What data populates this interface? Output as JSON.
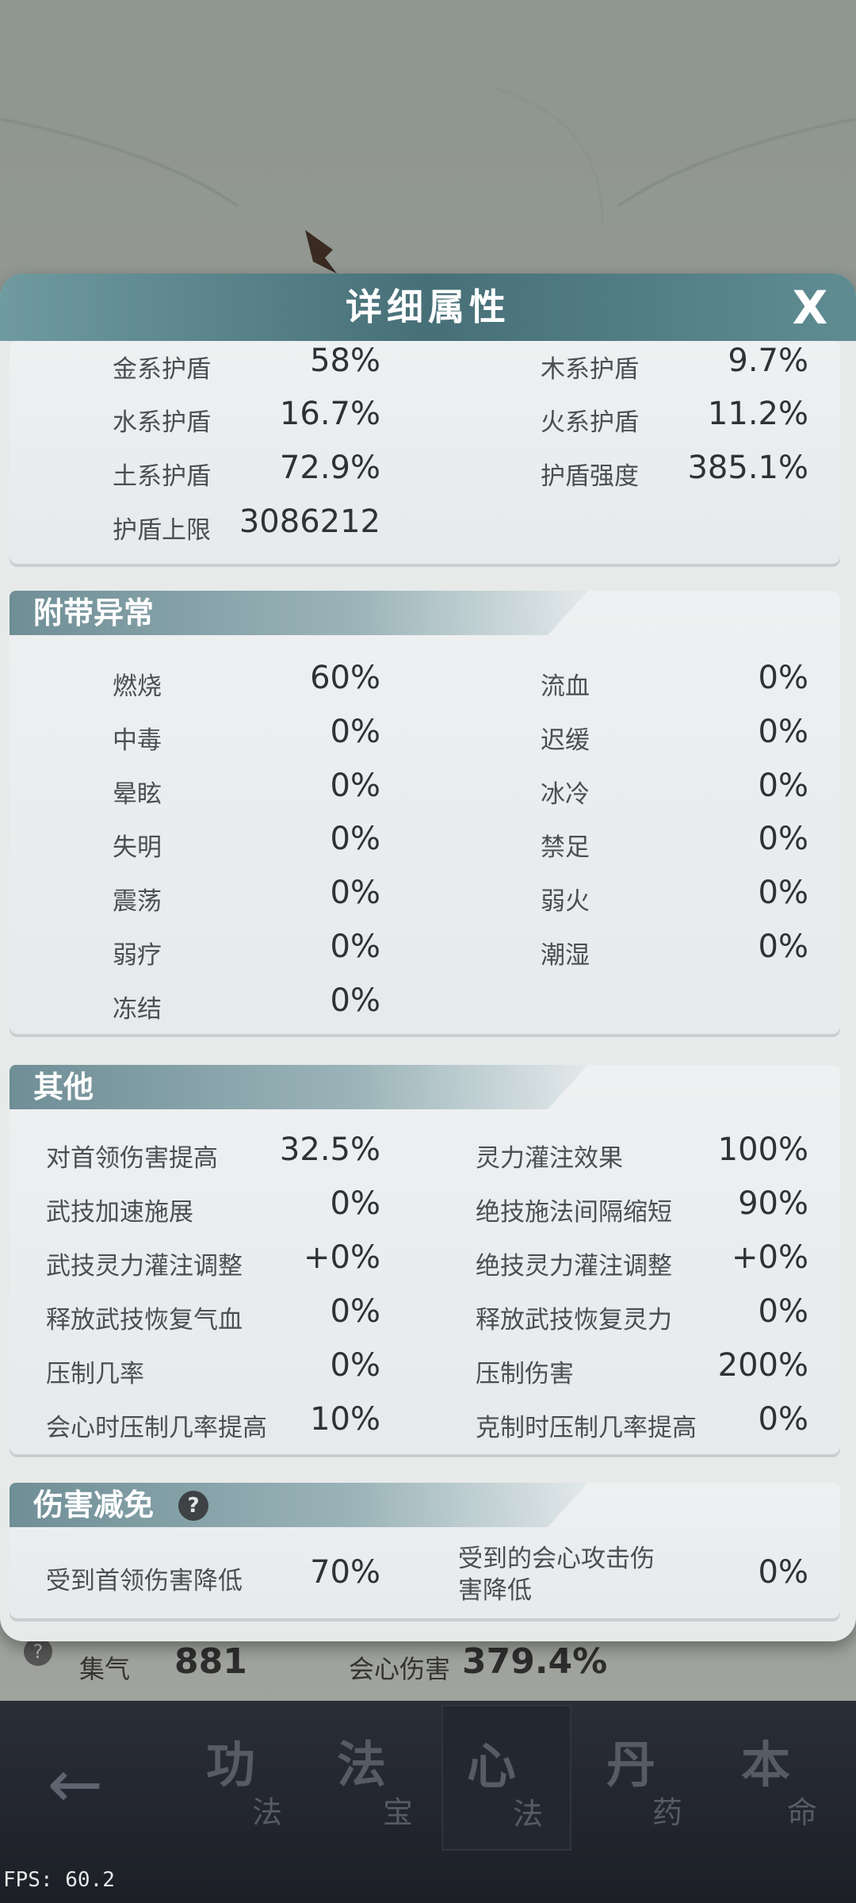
{
  "background": {
    "under_stats": {
      "left_label": "集气",
      "left_value": "881",
      "right_label": "会心伤害",
      "right_value": "379.4%"
    }
  },
  "dialog": {
    "title": "详细属性",
    "close_label": "X"
  },
  "shield": {
    "rows": [
      {
        "left_label": "金系护盾",
        "left_value": "58%",
        "right_label": "木系护盾",
        "right_value": "9.7%"
      },
      {
        "left_label": "水系护盾",
        "left_value": "16.7%",
        "right_label": "火系护盾",
        "right_value": "11.2%"
      },
      {
        "left_label": "土系护盾",
        "left_value": "72.9%",
        "right_label": "护盾强度",
        "right_value": "385.1%"
      },
      {
        "left_label": "护盾上限",
        "left_value": "3086212",
        "right_label": "",
        "right_value": ""
      }
    ]
  },
  "abnormal": {
    "title": "附带异常",
    "rows": [
      {
        "left_label": "燃烧",
        "left_value": "60%",
        "right_label": "流血",
        "right_value": "0%"
      },
      {
        "left_label": "中毒",
        "left_value": "0%",
        "right_label": "迟缓",
        "right_value": "0%"
      },
      {
        "left_label": "晕眩",
        "left_value": "0%",
        "right_label": "冰冷",
        "right_value": "0%"
      },
      {
        "left_label": "失明",
        "left_value": "0%",
        "right_label": "禁足",
        "right_value": "0%"
      },
      {
        "left_label": "震荡",
        "left_value": "0%",
        "right_label": "弱火",
        "right_value": "0%"
      },
      {
        "left_label": "弱疗",
        "left_value": "0%",
        "right_label": "潮湿",
        "right_value": "0%"
      },
      {
        "left_label": "冻结",
        "left_value": "0%",
        "right_label": "",
        "right_value": ""
      }
    ]
  },
  "other": {
    "title": "其他",
    "rows": [
      {
        "left_label": "对首领伤害提高",
        "left_value": "32.5%",
        "right_label": "灵力灌注效果",
        "right_value": "100%"
      },
      {
        "left_label": "武技加速施展",
        "left_value": "0%",
        "right_label": "绝技施法间隔缩短",
        "right_value": "90%"
      },
      {
        "left_label": "武技灵力灌注调整",
        "left_value": "+0%",
        "right_label": "绝技灵力灌注调整",
        "right_value": "+0%"
      },
      {
        "left_label": "释放武技恢复气血",
        "left_value": "0%",
        "right_label": "释放武技恢复灵力",
        "right_value": "0%"
      },
      {
        "left_label": "压制几率",
        "left_value": "0%",
        "right_label": "压制伤害",
        "right_value": "200%"
      },
      {
        "left_label": "会心时压制几率提高",
        "left_value": "10%",
        "right_label": "克制时压制几率提高",
        "right_value": "0%"
      }
    ]
  },
  "damage_reduction": {
    "title": "伤害减免",
    "help": "?",
    "left_label": "受到首领伤害降低",
    "left_value": "70%",
    "right_label_line1": "受到的会心攻击伤",
    "right_label_line2": "害降低",
    "right_value": "0%"
  },
  "nav": {
    "back": "←",
    "tabs": [
      {
        "big": "功",
        "small": "法"
      },
      {
        "big": "法",
        "small": "宝"
      },
      {
        "big": "心",
        "small": "法"
      },
      {
        "big": "丹",
        "small": "药"
      },
      {
        "big": "本",
        "small": "命"
      }
    ]
  },
  "fps": "FPS: 60.2"
}
